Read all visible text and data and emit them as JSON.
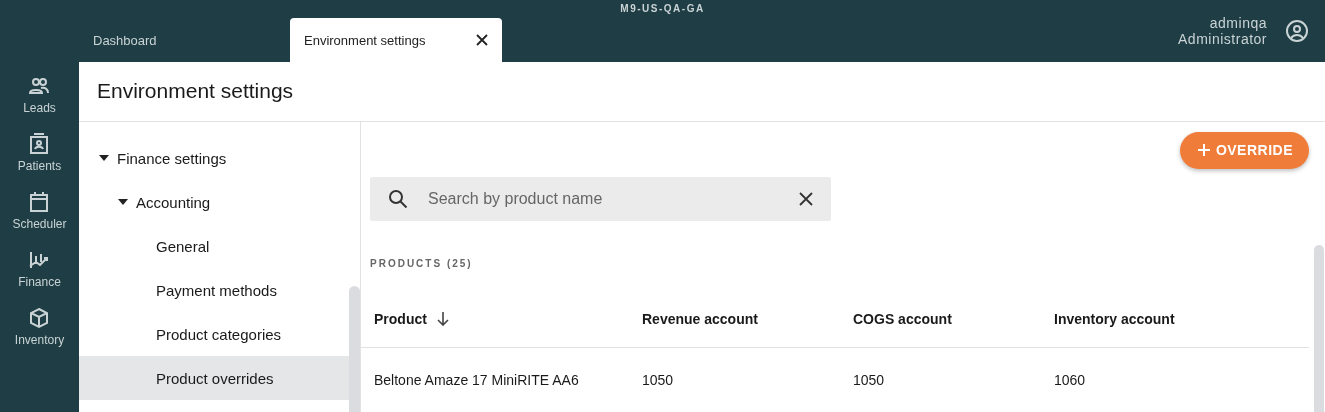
{
  "environment": {
    "name": "M9-US-QA-GA"
  },
  "tabs": [
    {
      "label": "Dashboard",
      "selected": false,
      "closable": false
    },
    {
      "label": "Environment settings",
      "selected": true,
      "closable": true
    }
  ],
  "user": {
    "name": "adminqa",
    "role": "Administrator"
  },
  "nav": [
    {
      "label": "Leads",
      "kind": "people"
    },
    {
      "label": "Patients",
      "kind": "badge"
    },
    {
      "label": "Scheduler",
      "kind": "calendar"
    },
    {
      "label": "Finance",
      "kind": "chart"
    },
    {
      "label": "Inventory",
      "kind": "box"
    }
  ],
  "page_title": "Environment settings",
  "tree": [
    {
      "label": "Finance settings",
      "expanded": true,
      "selected": false,
      "children": [
        {
          "label": "Accounting",
          "expanded": true,
          "selected": false,
          "children": [
            {
              "label": "General",
              "selected": false
            },
            {
              "label": "Payment methods",
              "selected": false
            },
            {
              "label": "Product categories",
              "selected": false
            },
            {
              "label": "Product overrides",
              "selected": true
            }
          ]
        }
      ]
    }
  ],
  "override_button": "OVERRIDE",
  "search": {
    "placeholder": "Search by product name"
  },
  "products_heading": "PRODUCTS (25)",
  "table": {
    "columns": [
      {
        "label": "Product",
        "sorted": true
      },
      {
        "label": "Revenue account",
        "sorted": false
      },
      {
        "label": "COGS account",
        "sorted": false
      },
      {
        "label": "Inventory account",
        "sorted": false
      }
    ],
    "rows": [
      [
        "Beltone Amaze 17 MiniRITE AA6",
        "1050",
        "1050",
        "1060"
      ]
    ]
  }
}
